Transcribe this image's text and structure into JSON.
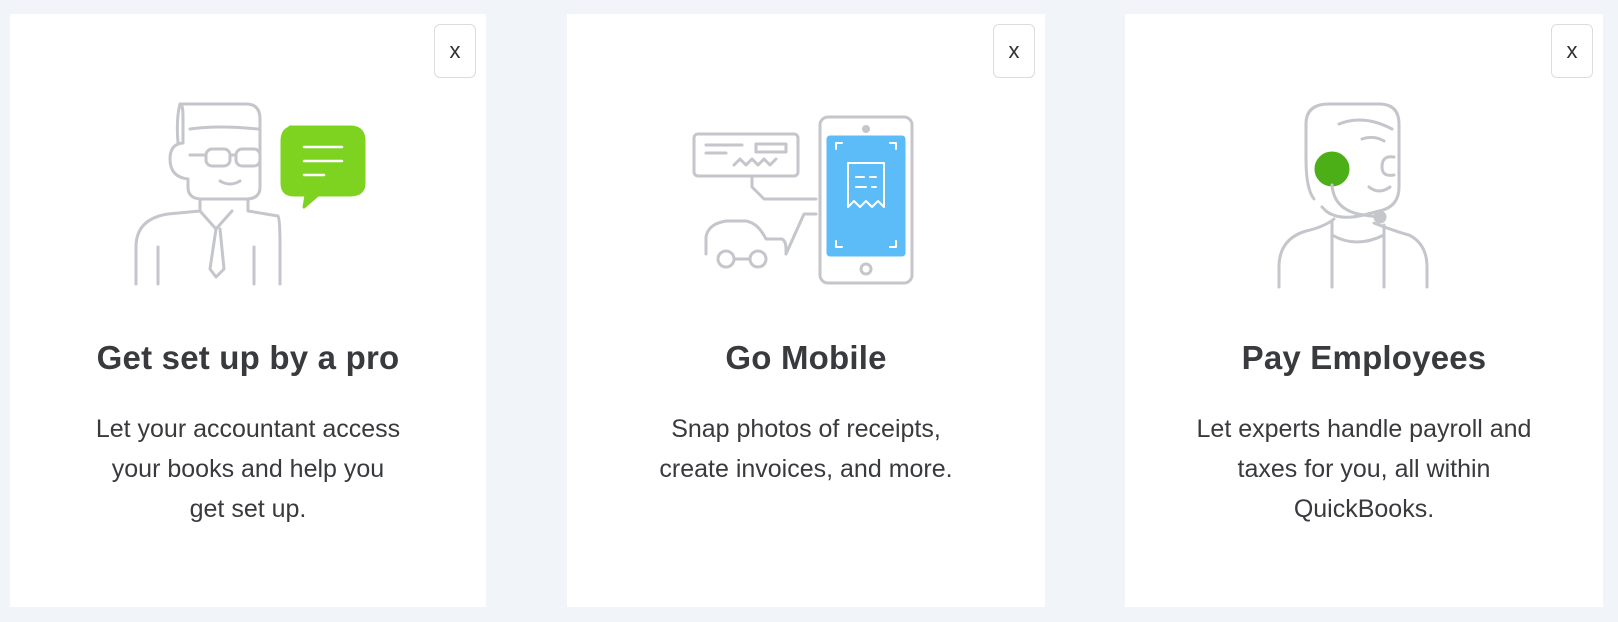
{
  "colors": {
    "background": "#f1f4f9",
    "card": "#ffffff",
    "text": "#393a3d",
    "line_art": "#c4c6cc",
    "accent_green": "#7ed321",
    "accent_green_dark": "#4caf18",
    "accent_blue": "#5bbcf8"
  },
  "cards": [
    {
      "close_label": "x",
      "icon": "accountant-chat-illustration",
      "title": "Get set up by a pro",
      "description": "Let your accountant access your books and help you get set up."
    },
    {
      "close_label": "x",
      "icon": "mobile-receipt-illustration",
      "title": "Go Mobile",
      "description": "Snap photos of receipts, create invoices, and more."
    },
    {
      "close_label": "x",
      "icon": "payroll-support-illustration",
      "title": "Pay Employees",
      "description": "Let experts handle payroll and taxes for you, all within QuickBooks."
    }
  ]
}
